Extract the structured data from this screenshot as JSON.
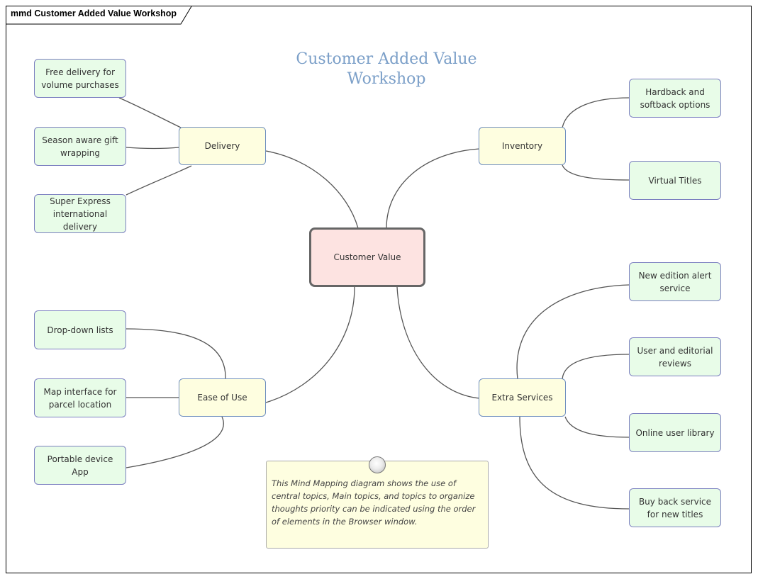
{
  "frame": {
    "label": "mmd Customer Added Value Workshop"
  },
  "diagram": {
    "title_line1": "Customer Added Value",
    "title_line2": "Workshop",
    "colors": {
      "central_fill": "#fde3e1",
      "main_fill": "#fefee0",
      "topic_fill": "#e8fce8",
      "title_text": "#7b9fc8",
      "note_fill": "#fefee0"
    },
    "central": {
      "label": "Customer Value"
    },
    "main_topics": [
      {
        "label": "Delivery"
      },
      {
        "label": "Inventory"
      },
      {
        "label": "Ease of Use"
      },
      {
        "label": "Extra Services"
      }
    ],
    "topics": {
      "delivery": [
        "Free delivery for volume purchases",
        "Season aware gift wrapping",
        "Super Express international delivery"
      ],
      "inventory": [
        "Hardback and softback options",
        "Virtual Titles"
      ],
      "ease_of_use": [
        "Drop-down lists",
        "Map interface for parcel location",
        "Portable device App"
      ],
      "extra_services": [
        "New edition alert service",
        "User and editorial reviews",
        "Online user library",
        "Buy back service for new titles"
      ]
    },
    "note": {
      "text": "This Mind Mapping diagram shows the use of central topics, Main topics, and topics to organize thoughts priority can be indicated using the order of elements in the Browser window."
    }
  }
}
